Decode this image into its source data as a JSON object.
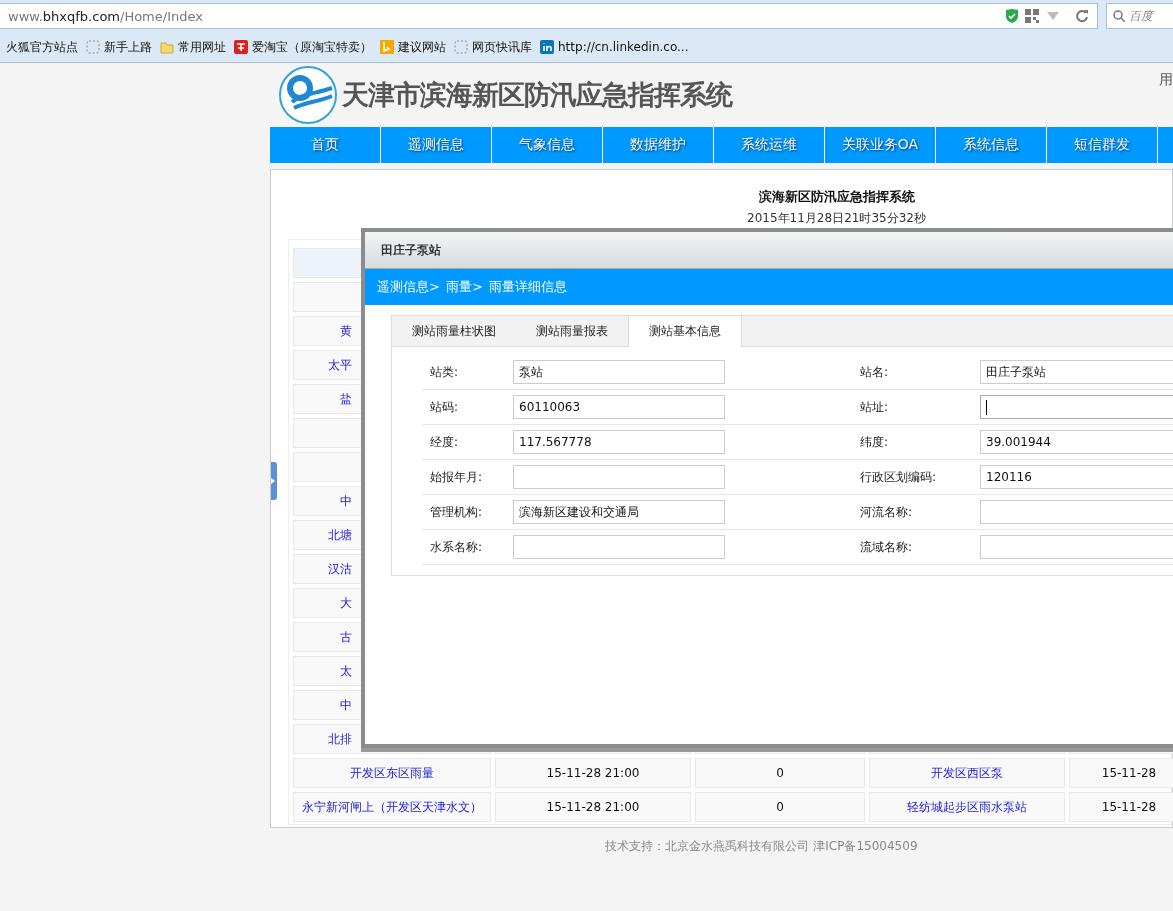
{
  "browser": {
    "url": "www.**bhxqfb.com**/Home/Index",
    "search_placeholder": "百度",
    "bookmarks": [
      {
        "kind": "plain",
        "label": "火狐官方站点"
      },
      {
        "kind": "dotted",
        "label": "新手上路"
      },
      {
        "kind": "folder",
        "label": "常用网址"
      },
      {
        "kind": "taobao",
        "label": "爱淘宝（原淘宝特卖）"
      },
      {
        "kind": "bing",
        "label": "建议网站"
      },
      {
        "kind": "dotted",
        "label": "网页快讯库"
      },
      {
        "kind": "linkedin",
        "label": "http://cn.linkedin.co..."
      }
    ]
  },
  "header": {
    "title": "天津市滨海新区防汛应急指挥系统",
    "user": "用"
  },
  "nav": [
    "首页",
    "遥测信息",
    "气象信息",
    "数据维护",
    "系统运维",
    "关联业务OA",
    "系统信息",
    "短信群发"
  ],
  "panel": {
    "title": "滨海新区防汛应急指挥系统",
    "datetime": "2015年11月28日21时35分32秒"
  },
  "table": {
    "rows": [
      {
        "cells": [
          "",
          "",
          "",
          "",
          ""
        ]
      },
      {
        "cells": [
          "",
          "",
          "",
          "",
          ""
        ]
      },
      {
        "cells": [
          "黄",
          "",
          "",
          "",
          ""
        ]
      },
      {
        "cells": [
          "太平",
          "",
          "",
          "",
          ""
        ]
      },
      {
        "cells": [
          "盐",
          "",
          "",
          "",
          ""
        ]
      },
      {
        "cells": [
          "",
          "",
          "",
          "",
          ""
        ]
      },
      {
        "cells": [
          "",
          "",
          "",
          "",
          ""
        ]
      },
      {
        "cells": [
          "中",
          "",
          "",
          "",
          ""
        ]
      },
      {
        "cells": [
          "北塘",
          "",
          "",
          "",
          ""
        ]
      },
      {
        "cells": [
          "汉沽",
          "",
          "",
          "",
          ""
        ]
      },
      {
        "cells": [
          "大",
          "",
          "",
          "",
          ""
        ]
      },
      {
        "cells": [
          "古",
          "",
          "",
          "",
          ""
        ]
      },
      {
        "cells": [
          "太",
          "",
          "",
          "",
          ""
        ]
      },
      {
        "cells": [
          "中",
          "",
          "",
          "",
          ""
        ]
      },
      {
        "cells": [
          "北排",
          "",
          "",
          "",
          ""
        ]
      },
      {
        "cells": [
          "开发区东区雨量",
          "15-11-28 21:00",
          "0",
          "开发区西区泵",
          "15-11-28"
        ]
      },
      {
        "cells": [
          "永宁新河闸上（开发区天津水文）",
          "15-11-28 21:00",
          "0",
          "轻纺城起步区雨水泵站",
          "15-11-28"
        ]
      }
    ]
  },
  "dialog": {
    "title": "田庄子泵站",
    "breadcrumb": [
      "遥测信息>",
      "雨量>",
      "雨量详细信息"
    ],
    "tabs": [
      {
        "label": "测站雨量柱状图",
        "selected": false
      },
      {
        "label": "测站雨量报表",
        "selected": false
      },
      {
        "label": "测站基本信息",
        "selected": true
      }
    ],
    "fields": [
      {
        "label": "站类:",
        "value": "泵站",
        "focused": false
      },
      {
        "label": "站名:",
        "value": "田庄子泵站",
        "focused": false
      },
      {
        "label": "站码:",
        "value": "60110063",
        "focused": false
      },
      {
        "label": "站址:",
        "focused": true
      },
      {
        "label": "经度:",
        "value": "117.567778",
        "focused": false
      },
      {
        "label": "纬度:",
        "value": "39.001944",
        "focused": false
      },
      {
        "label": "始报年月:",
        "focused": false
      },
      {
        "label": "行政区划编码:",
        "value": "120116",
        "focused": false
      },
      {
        "label": "管理机构:",
        "value": "滨海新区建设和交通局",
        "focused": false
      },
      {
        "label": "河流名称:",
        "focused": false
      },
      {
        "label": "水系名称:",
        "focused": false
      },
      {
        "label": "流域名称:",
        "focused": false
      }
    ]
  },
  "footer": "技术支持：北京金水燕禹科技有限公司  津ICP备15004509"
}
